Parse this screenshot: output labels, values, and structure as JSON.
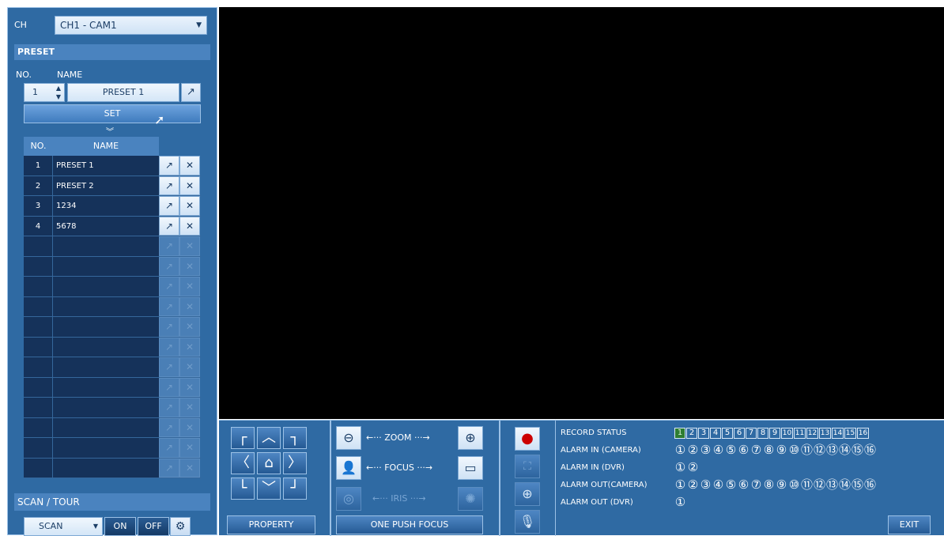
{
  "channel": {
    "label": "CH",
    "value": "CH1 - CAM1"
  },
  "preset": {
    "section_title": "PRESET",
    "no_label": "NO.",
    "name_label": "NAME",
    "current_no": "1",
    "current_name": "PRESET 1",
    "set_label": "SET",
    "table_headers": [
      "NO.",
      "NAME"
    ],
    "rows": [
      {
        "no": "1",
        "name": "PRESET 1"
      },
      {
        "no": "2",
        "name": "PRESET 2"
      },
      {
        "no": "3",
        "name": "1234"
      },
      {
        "no": "4",
        "name": "5678"
      }
    ]
  },
  "scan": {
    "section_title": "SCAN / TOUR",
    "mode": "SCAN",
    "on_label": "ON",
    "off_label": "OFF"
  },
  "ptz": {
    "property_label": "PROPERTY",
    "zoom_label": "ZOOM",
    "focus_label": "FOCUS",
    "iris_label": "IRIS",
    "one_push_focus_label": "ONE PUSH FOCUS"
  },
  "status": {
    "record_status_label": "RECORD STATUS",
    "alarm_in_camera_label": "ALARM IN (CAMERA)",
    "alarm_in_dvr_label": "ALARM IN (DVR)",
    "alarm_out_camera_label": "ALARM OUT(CAMERA)",
    "alarm_out_dvr_label": "ALARM OUT (DVR)",
    "record_channels": [
      "1",
      "2",
      "3",
      "4",
      "5",
      "6",
      "7",
      "8",
      "9",
      "10",
      "11",
      "12",
      "13",
      "14",
      "15",
      "16"
    ],
    "record_active": [
      "1"
    ],
    "alarm_in_camera": [
      "①",
      "②",
      "③",
      "④",
      "⑤",
      "⑥",
      "⑦",
      "⑧",
      "⑨",
      "⑩",
      "⑪",
      "⑫",
      "⑬",
      "⑭",
      "⑮",
      "⑯"
    ],
    "alarm_in_dvr": [
      "①",
      "②"
    ],
    "alarm_out_camera": [
      "①",
      "②",
      "③",
      "④",
      "⑤",
      "⑥",
      "⑦",
      "⑧",
      "⑨",
      "⑩",
      "⑪",
      "⑫",
      "⑬",
      "⑭",
      "⑮",
      "⑯"
    ],
    "alarm_out_dvr": [
      "①"
    ],
    "exit_label": "EXIT"
  },
  "colors": {
    "panel": "#2f6aa3",
    "record_active": "#2e7d32",
    "video_bg": "#000000"
  }
}
